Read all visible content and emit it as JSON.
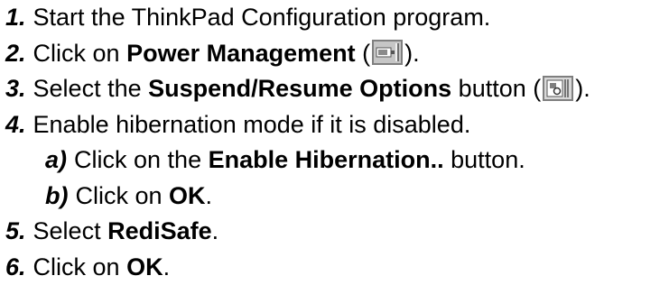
{
  "steps": [
    {
      "num": "1.",
      "parts": [
        "Start the ThinkPad Configuration program."
      ]
    },
    {
      "num": "2.",
      "pre": "Click on ",
      "bold": "Power Management",
      "post_open": " (",
      "post_close": ")."
    },
    {
      "num": "3.",
      "pre": "Select the ",
      "bold": "Suspend/Resume Options",
      "mid": " button (",
      "post_close": ")."
    },
    {
      "num": "4.",
      "parts": [
        "Enable hibernation mode if it is disabled."
      ]
    },
    {
      "num": "a)",
      "pre": "Click on the ",
      "bold": "Enable Hibernation..",
      "post": " button."
    },
    {
      "num": "b)",
      "pre": "Click on ",
      "bold": "OK",
      "post": "."
    },
    {
      "num": "5.",
      "pre": "Select ",
      "bold": "RediSafe",
      "post": "."
    },
    {
      "num": "6.",
      "pre": "Click on ",
      "bold": "OK",
      "post": "."
    }
  ],
  "icons": {
    "power_management": "power-management-icon",
    "suspend_resume": "suspend-resume-options-icon"
  }
}
